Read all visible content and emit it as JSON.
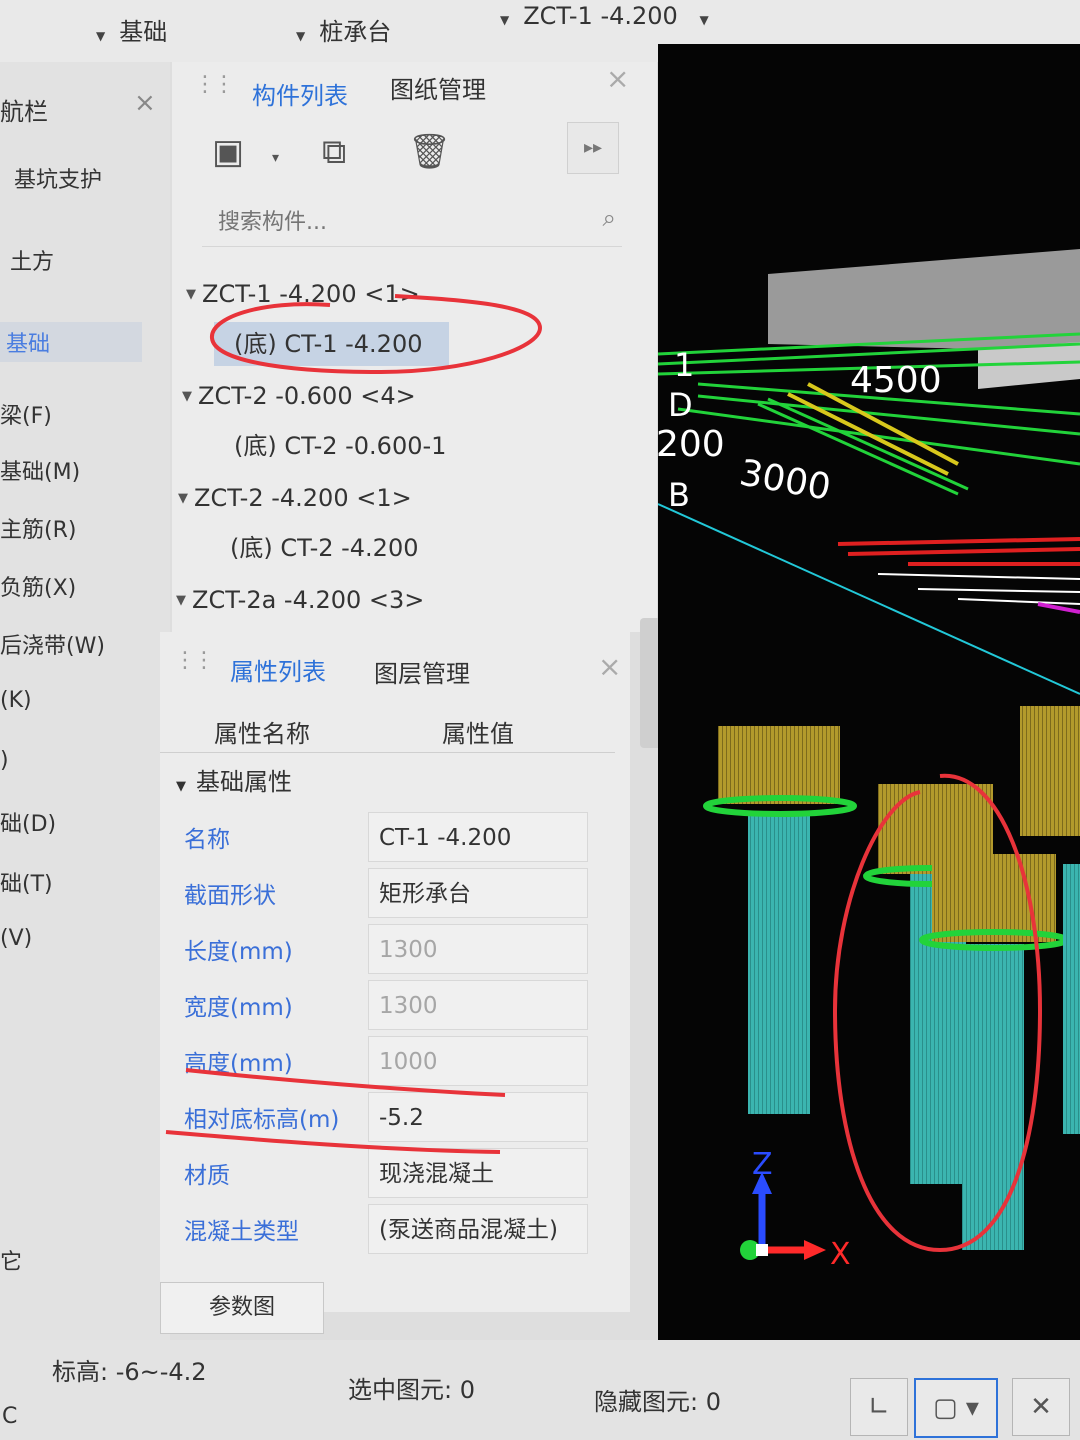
{
  "topbar": {
    "floor_type": "基础",
    "component_type": "桩承台",
    "component": "ZCT-1   -4.200"
  },
  "nav": {
    "title": "航栏",
    "items": [
      "基坑支护",
      "土方",
      "基础",
      "梁(F)",
      "基础(M)",
      "主筋(R)",
      "负筋(X)",
      "后浇带(W)",
      "(K)",
      ")",
      "础(D)",
      "础(T)",
      "(V)",
      "它"
    ],
    "active_index": 2
  },
  "component_panel": {
    "tabs": [
      "构件列表",
      "图纸管理"
    ],
    "search_placeholder": "搜索构件...",
    "tree": [
      {
        "label": "ZCT-1   -4.200 <1>",
        "level": 0
      },
      {
        "label": "(底)  CT-1   -4.200",
        "level": 1,
        "selected": true
      },
      {
        "label": "ZCT-2   -0.600 <4>",
        "level": 0
      },
      {
        "label": "(底)  CT-2   -0.600-1",
        "level": 1
      },
      {
        "label": "ZCT-2   -4.200 <1>",
        "level": 0
      },
      {
        "label": "(底)  CT-2   -4.200",
        "level": 1
      },
      {
        "label": "ZCT-2a   -4.200 <3>",
        "level": 0
      }
    ]
  },
  "property_panel": {
    "tabs": [
      "属性列表",
      "图层管理"
    ],
    "col_name": "属性名称",
    "col_value": "属性值",
    "group": "基础属性",
    "rows": [
      {
        "name": "名称",
        "value": "CT-1   -4.200",
        "gray": false
      },
      {
        "name": "截面形状",
        "value": "矩形承台",
        "gray": false
      },
      {
        "name": "长度(mm)",
        "value": "1300",
        "gray": true
      },
      {
        "name": "宽度(mm)",
        "value": "1300",
        "gray": true
      },
      {
        "name": "高度(mm)",
        "value": "1000",
        "gray": true
      },
      {
        "name": "相对底标高(m)",
        "value": "-5.2",
        "gray": false
      },
      {
        "name": "材质",
        "value": "现浇混凝土",
        "gray": false
      },
      {
        "name": "混凝土类型",
        "value": "(泵送商品混凝土)",
        "gray": false
      }
    ],
    "param_button": "参数图"
  },
  "viewport": {
    "dim_labels": [
      "4500",
      "3000",
      "200"
    ],
    "grid_labels": [
      "1",
      "D",
      "B"
    ],
    "axis_z": "Z",
    "axis_x": "X"
  },
  "status": {
    "elevation": "标高:  -6~-4.2",
    "selected": "选中图元:  0",
    "hidden": "隐藏图元:  0",
    "corner": "C"
  },
  "colors": {
    "accent": "#2e72d9",
    "annotation": "#e8333a",
    "pile": "#3bb5b0",
    "cap": "#b39a2c",
    "rebar": "#22d33a"
  }
}
